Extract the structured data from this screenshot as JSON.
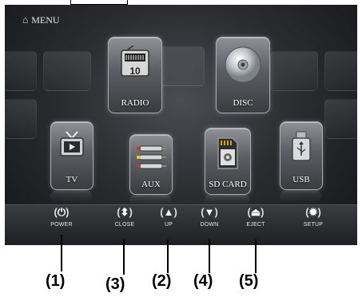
{
  "menu": {
    "title": "MENU"
  },
  "tiles": [
    {
      "label": "RADIO",
      "icon": "radio-icon"
    },
    {
      "label": "DISC",
      "icon": "disc-icon"
    },
    {
      "label": "TV",
      "icon": "tv-icon"
    },
    {
      "label": "AUX",
      "icon": "aux-icon"
    },
    {
      "label": "SD CARD",
      "icon": "sd-card-icon"
    },
    {
      "label": "USB",
      "icon": "usb-icon"
    }
  ],
  "controls": [
    {
      "label": "POWER",
      "icon": "power-icon",
      "glyph": "⏻"
    },
    {
      "label": "CLOSE",
      "icon": "close-icon",
      "glyph": "⬍"
    },
    {
      "label": "UP",
      "icon": "up-arrow-icon",
      "glyph": "▲"
    },
    {
      "label": "DOWN",
      "icon": "down-arrow-icon",
      "glyph": "▼"
    },
    {
      "label": "EJECT",
      "icon": "eject-icon",
      "glyph": "⏏"
    },
    {
      "label": "SETUP",
      "icon": "gear-icon",
      "glyph": "✹"
    }
  ],
  "callouts": [
    "(1)",
    "(3)",
    "(2)",
    "(4)",
    "(5)"
  ]
}
